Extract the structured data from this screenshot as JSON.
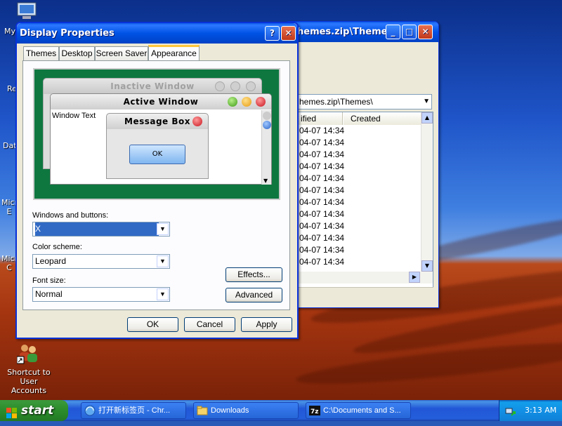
{
  "desktop": {
    "icons": [
      {
        "label": "My"
      },
      {
        "label": "Re"
      },
      {
        "label": "Dat"
      },
      {
        "label": "Micr E"
      },
      {
        "label": "Micr C"
      }
    ],
    "shortcut": {
      "label1": "Shortcut to",
      "label2": "User Accounts",
      "icon": "users-icon"
    }
  },
  "explorer": {
    "title": "hemes.zip\\Themes\\",
    "address": "hemes.zip\\Themes\\",
    "col_modified": "ified",
    "col_created": "Created",
    "rows": [
      "04-07 14:34",
      "04-07 14:34",
      "04-07 14:34",
      "04-07 14:34",
      "04-07 14:34",
      "04-07 14:34",
      "04-07 14:34",
      "04-07 14:34",
      "04-07 14:34",
      "04-07 14:34",
      "04-07 14:34",
      "04-07 14:34"
    ]
  },
  "dialog": {
    "title": "Display Properties",
    "help": "?",
    "close": "✕",
    "tabs": [
      "Themes",
      "Desktop",
      "Screen Saver",
      "Appearance"
    ],
    "preview": {
      "inactive": "Inactive Window",
      "active": "Active Window",
      "text": "Window Text",
      "msgbox": "Message Box",
      "ok": "OK"
    },
    "windows_label": "Windows and buttons:",
    "windows_value": "X",
    "scheme_label": "Color scheme:",
    "scheme_value": "Leopard",
    "font_label": "Font size:",
    "font_value": "Normal",
    "effects": "Effects...",
    "advanced": "Advanced",
    "ok": "OK",
    "cancel": "Cancel",
    "apply": "Apply"
  },
  "taskbar": {
    "start": "start",
    "tasks": [
      "打开新标签页 - Chr...",
      "Downloads",
      "C:\\Documents and S..."
    ],
    "clock": "3:13 AM"
  }
}
